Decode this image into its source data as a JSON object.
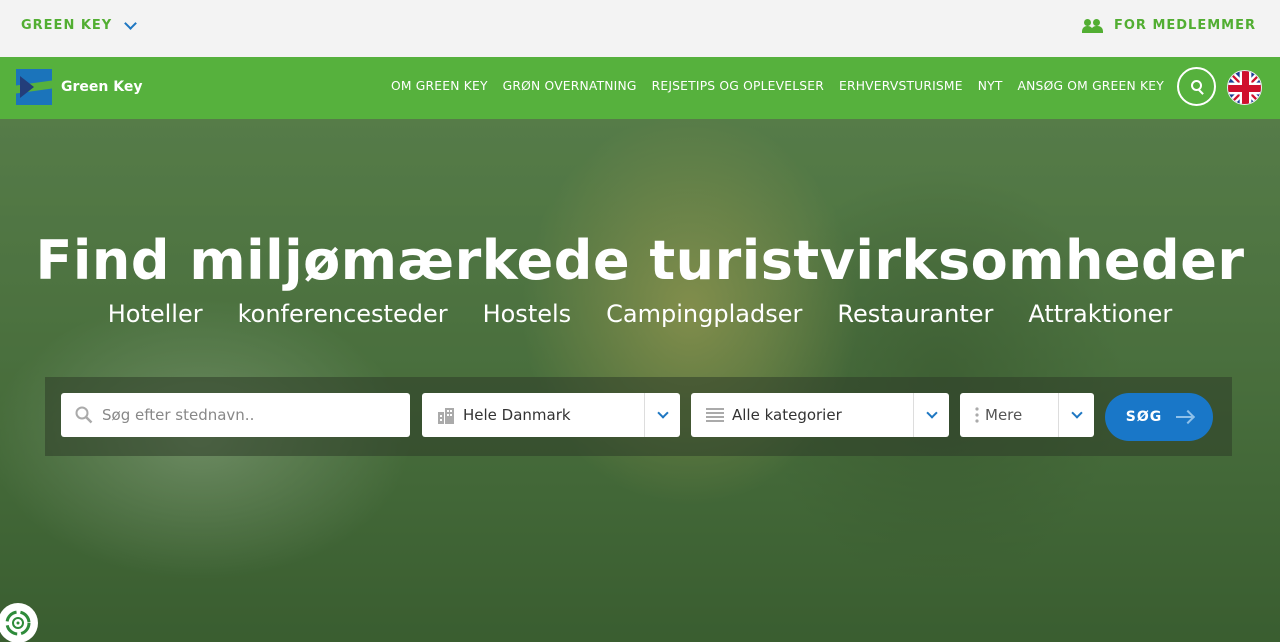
{
  "topbar": {
    "brand_switch": "GREEN KEY",
    "members": "FOR MEDLEMMER"
  },
  "navbar": {
    "logo_text": "Green Key",
    "menu": [
      "OM GREEN KEY",
      "GRØN OVERNATNING",
      "REJSETIPS OG OPLEVELSER",
      "ERHVERVSTURISME",
      "NYT",
      "ANSØG OM GREEN KEY"
    ]
  },
  "hero": {
    "title": "Find miljømærkede turistvirksomheder",
    "categories": [
      "Hoteller",
      "konferencesteder",
      "Hostels",
      "Campingpladser",
      "Restauranter",
      "Attraktioner"
    ]
  },
  "search": {
    "placeholder": "Søg efter stednavn..",
    "region": "Hele Danmark",
    "category": "Alle kategorier",
    "more": "Mere",
    "button": "SØG"
  },
  "colors": {
    "green": "#56b13d",
    "blue": "#1977c8",
    "topbar_bg": "#f3f3f3"
  }
}
